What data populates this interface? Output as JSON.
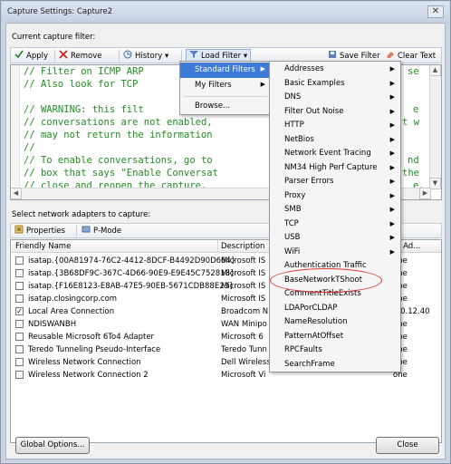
{
  "window": {
    "title": "Capture Settings: Capture2",
    "close_glyph": "✕"
  },
  "filter_section": {
    "label": "Current capture filter:"
  },
  "toolbar": {
    "apply": "Apply",
    "remove": "Remove",
    "history": "History",
    "load_filter": "Load Filter",
    "save_filter": "Save Filter",
    "clear_text": "Clear Text"
  },
  "code_lines": [
    "// Filter on ICMP ARP",
    "// Also look for TCP",
    "",
    "// WARNING: this filt",
    "// conversations are not enabled,",
    "// may not return the information",
    "//",
    "// To enable conversations, go to",
    "// box that says \"Enable Conversat",
    "// close and reopen the capture."
  ],
  "code_right_fragments": [
    "se",
    "e",
    "t w",
    "nd",
    "the",
    "e."
  ],
  "adapters": {
    "label": "Select network adapters to capture:",
    "properties": "Properties",
    "pmode": "P-Mode",
    "columns": {
      "name": "Friendly Name",
      "description": "Description",
      "ipv4": "v4 Ad..."
    },
    "rows": [
      {
        "checked": false,
        "name": "isatap.{00A81974-76C2-4412-8DCF-B4492D90D664}",
        "description": "Microsoft IS",
        "ipv4": "one"
      },
      {
        "checked": false,
        "name": "isatap.{3B68DF9C-367C-4D66-90E9-E9E45C752818}",
        "description": "Microsoft IS",
        "ipv4": "one"
      },
      {
        "checked": false,
        "name": "isatap.{F16E8123-E8AB-47E5-90EB-5671CDB88E23}",
        "description": "Microsoft IS",
        "ipv4": "one"
      },
      {
        "checked": false,
        "name": "isatap.closingcorp.com",
        "description": "Microsoft IS",
        "ipv4": "one"
      },
      {
        "checked": true,
        "name": "Local Area Connection",
        "description": "Broadcom N",
        "ipv4": "0.0.12.40"
      },
      {
        "checked": false,
        "name": "NDISWANBH",
        "description": "WAN Minipo",
        "ipv4": "one"
      },
      {
        "checked": false,
        "name": "Reusable Microsoft 6To4 Adapter",
        "description": "Microsoft 6",
        "ipv4": "one"
      },
      {
        "checked": false,
        "name": "Teredo Tunneling Pseudo-Interface",
        "description": "Teredo Tunn",
        "ipv4": "one"
      },
      {
        "checked": false,
        "name": "Wireless Network Connection",
        "description": "Dell Wireless",
        "ipv4": "one"
      },
      {
        "checked": false,
        "name": "Wireless Network Connection 2",
        "description": "Microsoft Vi",
        "ipv4": "one"
      }
    ]
  },
  "buttons": {
    "global_options": "Global Options...",
    "close": "Close"
  },
  "load_filter_menu": {
    "items": [
      "Standard Filters",
      "My Filters",
      "Browse..."
    ]
  },
  "standard_filters_menu": {
    "items": [
      "Addresses",
      "Basic Examples",
      "DNS",
      "Filter Out Noise",
      "HTTP",
      "NetBios",
      "Network Event Tracing",
      "NM34 High Perf Capture",
      "Parser Errors",
      "Proxy",
      "SMB",
      "TCP",
      "USB",
      "WiFi",
      "Authentication Traffic",
      "BaseNetworkTShoot",
      "CommentTitleExists",
      "LDAPorCLDAP",
      "NameResolution",
      "PatternAtOffset",
      "RPCFaults",
      "SearchFrame"
    ],
    "submenu_count": 14
  },
  "colors": {
    "highlight": "#3d7bd6",
    "comment_green": "#1f8f1f",
    "annotation_red": "#e03030"
  }
}
